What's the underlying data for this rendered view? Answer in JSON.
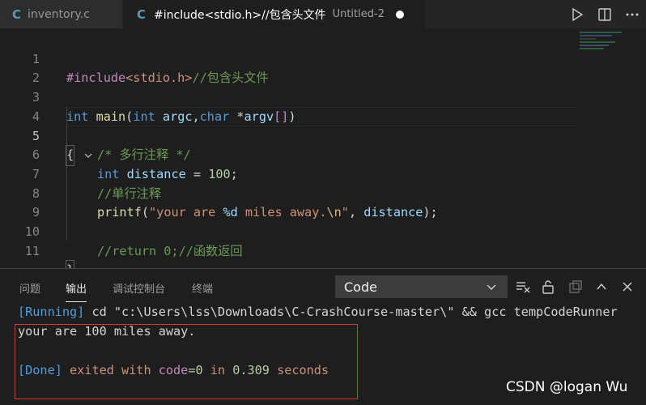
{
  "tabs": [
    {
      "icon": "C",
      "label": "inventory.c"
    },
    {
      "icon": "C",
      "label": "#include<stdio.h>//包含头文件",
      "description": "Untitled-2"
    }
  ],
  "tab_actions": [
    "run-icon",
    "split-editor-icon",
    "more-actions-icon"
  ],
  "editor": {
    "line_numbers": [
      "1",
      "2",
      "3",
      "4",
      "5",
      "6",
      "7",
      "8",
      "9",
      "10",
      "11"
    ],
    "active_line": "5",
    "lines": {
      "l1": {
        "directive": "#include",
        "header": "<stdio.h>",
        "comment": "//包含头文件"
      },
      "l3": {
        "type1": "int",
        "fn": "main",
        "p1": "(",
        "type2": "int",
        "arg1": "argc",
        "comma": ",",
        "type3": "char",
        "star": " *",
        "arg2": "argv",
        "brackets": "[]",
        "close": ")"
      },
      "l4": {
        "brace": "{"
      },
      "l5": {
        "comment": "/* 多行注释 */"
      },
      "l6": {
        "type": "int",
        "var": "distance",
        "eq": " = ",
        "num": "100",
        "semi": ";"
      },
      "l7": {
        "comment": "//单行注释"
      },
      "l8": {
        "fn": "printf",
        "open": "(",
        "str1": "\"your are ",
        "fmt": "%d",
        "str2": " miles away.",
        "esc": "\\n",
        "str3": "\"",
        "sep": ", ",
        "var": "distance",
        "end": ");"
      },
      "l10": {
        "comment": "//return 0;//函数返回"
      },
      "l11": {
        "brace": "}"
      }
    }
  },
  "panel": {
    "tabs": [
      "问题",
      "输出",
      "调试控制台",
      "终端"
    ],
    "active_tab": "输出",
    "select_value": "Code",
    "actions": [
      "clear-output-icon",
      "lock-scroll-icon",
      "open-log-icon",
      "maximize-panel-icon",
      "close-panel-icon"
    ],
    "output": {
      "running_tag": "[Running]",
      "command": " cd \"c:\\Users\\lss\\Downloads\\C-CrashCourse-master\\\" && gcc tempCodeRunner",
      "result": "your are 100 miles away.",
      "done_tag": "[Done]",
      "exited_with": " exited with ",
      "code_label": "code",
      "code_value": "=0",
      "in_word": " in ",
      "seconds_value": "0.309",
      "seconds_word": " seconds"
    }
  },
  "watermark": "CSDN @logan Wu",
  "colors": {
    "accent": "#569cd6",
    "highlight_box": "#d43a3a",
    "comment": "#6a9955",
    "string": "#ce9178"
  }
}
